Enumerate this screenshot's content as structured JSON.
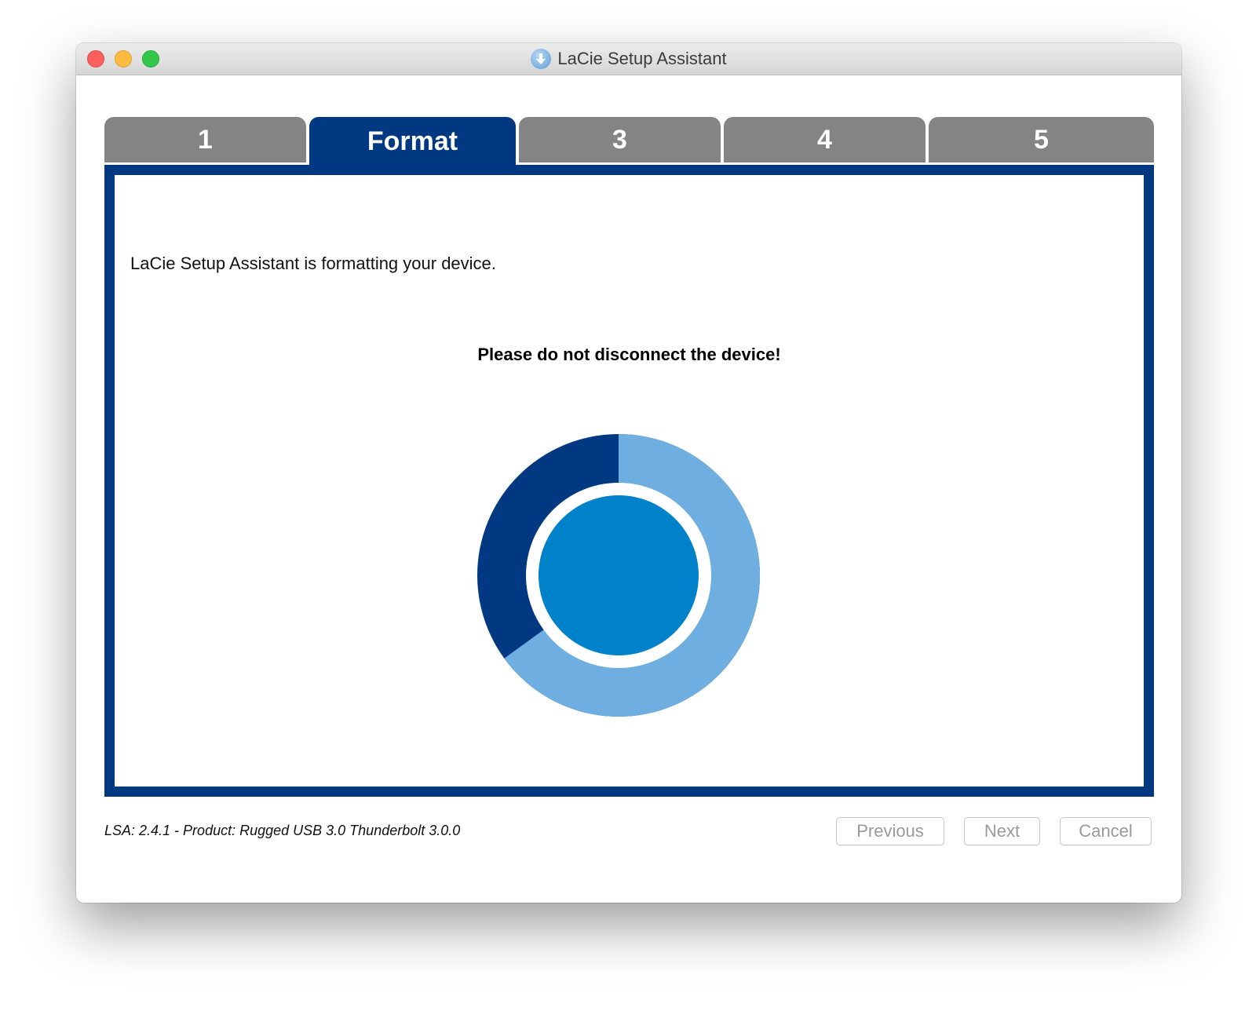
{
  "window": {
    "title": "LaCie Setup Assistant"
  },
  "tabs": [
    {
      "label": "1",
      "active": false
    },
    {
      "label": "Format",
      "active": true
    },
    {
      "label": "3",
      "active": false
    },
    {
      "label": "4",
      "active": false
    },
    {
      "label": "5",
      "active": false
    }
  ],
  "main": {
    "status_text": "LaCie Setup Assistant is formatting your device.",
    "warning_text": "Please do not disconnect the device!",
    "progress": {
      "fraction_shown": 0.65,
      "colors": {
        "progress": "#6eaee0",
        "remaining": "#003882",
        "center": "#0082ca"
      }
    }
  },
  "footer": {
    "info": "LSA: 2.4.1 - Product: Rugged USB 3.0 Thunderbolt 3.0.0",
    "buttons": {
      "previous": "Previous",
      "next": "Next",
      "cancel": "Cancel"
    }
  },
  "colors": {
    "brand_blue": "#003882",
    "tab_gray": "#848484"
  }
}
